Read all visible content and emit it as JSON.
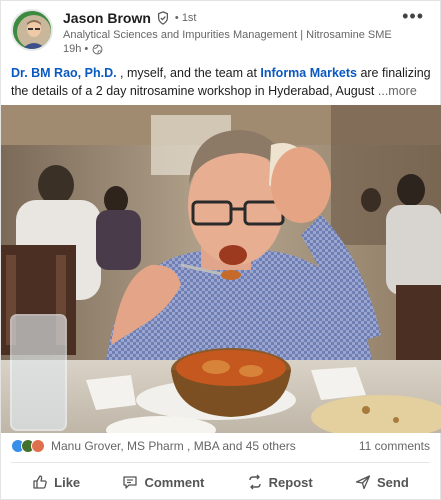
{
  "author": {
    "name": "Jason Brown",
    "degree": "• 1st",
    "headline": "Analytical Sciences and Impurities Management | Nitrosamine SME | ...",
    "time": "19h •",
    "avatar_badge": "#OPENTOWORK"
  },
  "post": {
    "mention_1": "Dr. BM Rao, Ph.D.",
    "text_1": " , myself, and the team at ",
    "mention_2": "Informa Markets",
    "text_2": " are finalizing the details of a 2 day nitrosamine workshop in Hyderabad, August ",
    "more": " ...more"
  },
  "social": {
    "reactors": "Manu Grover, MS Pharm , MBA and 45 others",
    "comments": "11 comments"
  },
  "actions": {
    "like": "Like",
    "comment": "Comment",
    "repost": "Repost",
    "send": "Send"
  },
  "colors": {
    "link": "#0a58c2",
    "like_blue": "#378fe9",
    "celebrate_green": "#44712e",
    "love_red": "#df704d"
  },
  "icons": [
    "verified-icon",
    "globe-icon",
    "more-options-icon",
    "like-icon",
    "comment-icon",
    "repost-icon",
    "send-icon"
  ]
}
